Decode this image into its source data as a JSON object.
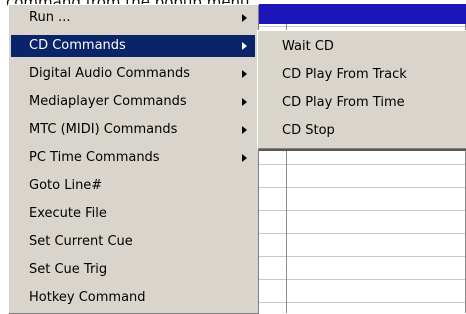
{
  "caption": "command from the popup menu.",
  "menu": {
    "items": [
      {
        "label": "Run ...",
        "submenu": true
      },
      {
        "label": "CD Commands",
        "submenu": true,
        "selected": true
      },
      {
        "label": "Digital Audio Commands",
        "submenu": true
      },
      {
        "label": "Mediaplayer Commands",
        "submenu": true
      },
      {
        "label": "MTC (MIDI) Commands",
        "submenu": true
      },
      {
        "label": "PC Time Commands",
        "submenu": true
      },
      {
        "label": "Goto Line#",
        "submenu": false
      },
      {
        "label": "Execute File",
        "submenu": false
      },
      {
        "label": "Set Current Cue",
        "submenu": false
      },
      {
        "label": "Set Cue Trig",
        "submenu": false
      },
      {
        "label": "Hotkey Command",
        "submenu": false
      }
    ]
  },
  "submenu": {
    "items": [
      {
        "label": "Wait CD"
      },
      {
        "label": "CD Play From Track"
      },
      {
        "label": "CD Play From Time"
      },
      {
        "label": "CD Stop"
      }
    ]
  },
  "colors": {
    "menu_bg": "#d9d5cc",
    "selection": "#0a246a",
    "grid_header": "#1c16b8"
  }
}
